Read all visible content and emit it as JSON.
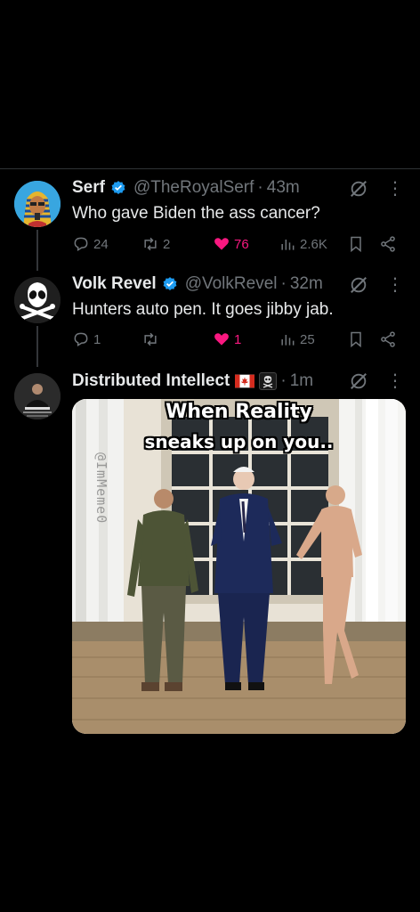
{
  "tweets": [
    {
      "name": "Serf",
      "handle": "@TheRoyalSerf",
      "time": "43m",
      "text": "Who gave Biden the ass cancer?",
      "replies": "24",
      "retweets": "2",
      "likes": "76",
      "views": "2.6K",
      "liked": true,
      "avatar_icon": "pharaoh-avatar"
    },
    {
      "name": "Volk Revel",
      "handle": "@VolkRevel",
      "time": "32m",
      "text": "Hunters auto pen. It goes jibby jab.",
      "replies": "1",
      "retweets": "",
      "likes": "1",
      "views": "25",
      "liked": true,
      "avatar_icon": "skull-crossbones-avatar"
    },
    {
      "name": "Distributed Intellect",
      "handle": "",
      "time": "1m",
      "text": "",
      "avatar_icon": "portrait-avatar",
      "badges": [
        "canada-flag",
        "skull-crossbones-badge"
      ]
    }
  ],
  "meme": {
    "line1": "When Reality",
    "line2": "sneaks up on you..",
    "watermark": "@ImMeme0"
  },
  "colors": {
    "background": "#000000",
    "text": "#e7e9ea",
    "secondary": "#71767b",
    "like": "#f91880",
    "verified": "#1d9bf0"
  }
}
